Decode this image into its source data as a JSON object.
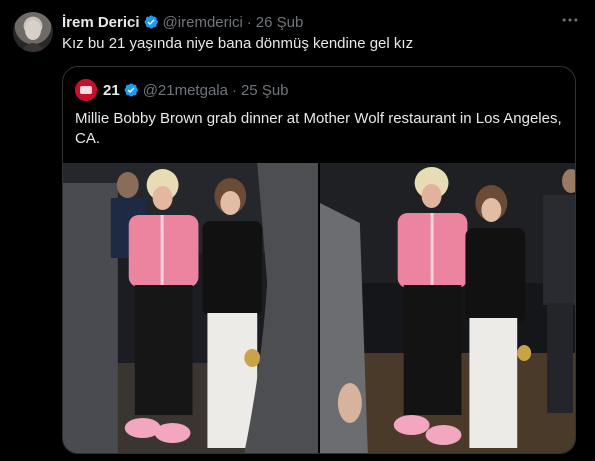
{
  "tweet": {
    "author_name": "İrem Derici",
    "author_handle": "@iremderici",
    "separator": "·",
    "time": "26 Şub",
    "text": "Kız bu 21 yaşında niye bana dönmüş kendine gel kız",
    "more_icon": "more-horizontal-icon"
  },
  "quoted_tweet": {
    "author_name": "21",
    "author_handle": "@21metgala",
    "separator": "·",
    "time": "25 Şub",
    "text": "Millie Bobby Brown grab dinner at Mother Wolf restaurant in Los Angeles, CA.",
    "photos": [
      "photo-1",
      "photo-2"
    ]
  },
  "colors": {
    "background": "#000000",
    "text_primary": "#e7e9ea",
    "text_secondary": "#71767b",
    "verified": "#1d9bf0",
    "border": "#2f3336"
  }
}
